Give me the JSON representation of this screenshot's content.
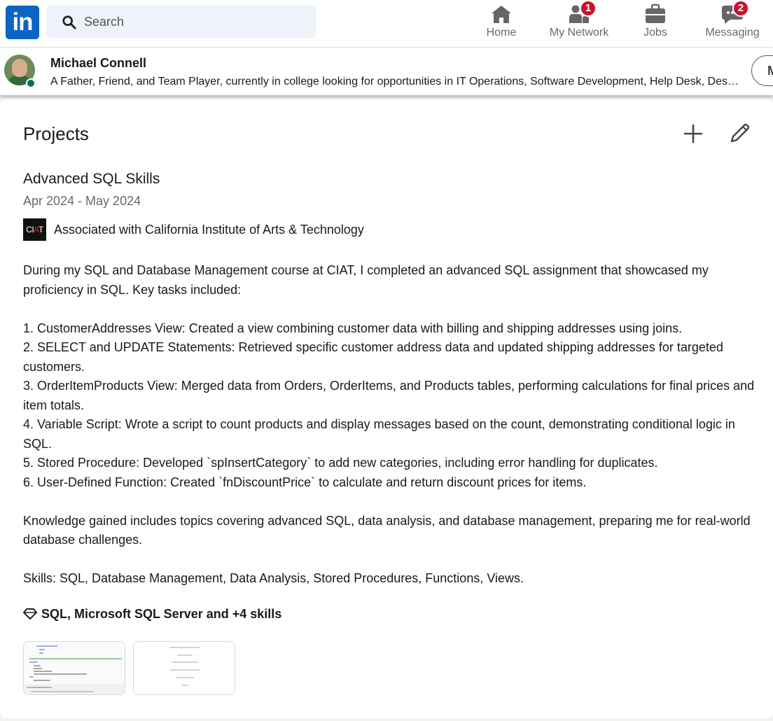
{
  "nav": {
    "logo_text": "in",
    "search_placeholder": "Search",
    "items": [
      {
        "label": "Home",
        "icon": "home-icon"
      },
      {
        "label": "My Network",
        "icon": "people-icon",
        "badge": "1"
      },
      {
        "label": "Jobs",
        "icon": "briefcase-icon"
      },
      {
        "label": "Messaging",
        "icon": "chat-icon",
        "badge": "2"
      }
    ]
  },
  "profile": {
    "name": "Michael Connell",
    "headline": "A Father, Friend, and Team Player, currently in college looking for opportunities in IT Operations, Software Development, Help Desk, Des…",
    "more_button": "M"
  },
  "section": {
    "title": "Projects"
  },
  "project": {
    "title": "Advanced SQL Skills",
    "dates": "Apr 2024 - May 2024",
    "association": "Associated with California Institute of Arts & Technology",
    "assoc_logo_text": "CIAT",
    "description": [
      "During my SQL and Database Management course at CIAT, I completed an advanced SQL assignment that showcased my proficiency in SQL. Key tasks included:",
      "",
      "1. CustomerAddresses View: Created a view combining customer data with billing and shipping addresses using joins.",
      "2. SELECT and UPDATE Statements: Retrieved specific customer address data and updated shipping addresses for targeted customers.",
      "3. OrderItemProducts View: Merged data from Orders, OrderItems, and Products tables, performing calculations for final prices and item totals.",
      "4. Variable Script: Wrote a script to count products and display messages based on the count, demonstrating conditional logic in SQL.",
      "5. Stored Procedure: Developed `spInsertCategory` to add new categories, including error handling for duplicates.",
      "6. User-Defined Function: Created `fnDiscountPrice` to calculate and return discount prices for items.",
      "",
      "Knowledge gained includes topics covering advanced SQL, data analysis, and database management, preparing me for real-world database challenges.",
      "",
      "Skills: SQL, Database Management, Data Analysis, Stored Procedures, Functions, Views."
    ],
    "skills_summary": "SQL, Microsoft SQL Server and +4 skills"
  },
  "colors": {
    "brand": "#0a66c2",
    "badge": "#cb112d",
    "online": "#01754f",
    "page_bg": "#f4f2ee"
  }
}
